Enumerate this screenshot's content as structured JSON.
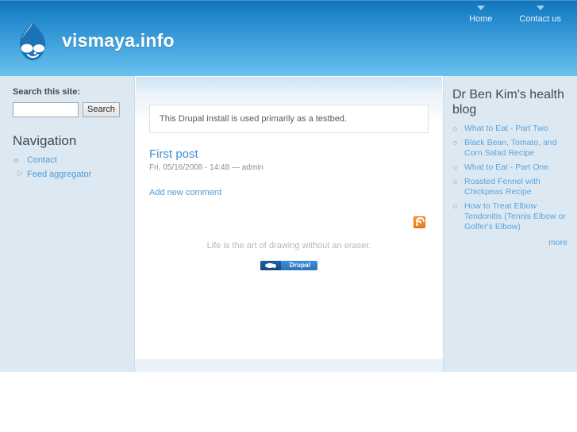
{
  "header": {
    "site_name": "vismaya.info",
    "logo_icon": "drupal-droplet-icon",
    "primary_links": [
      {
        "label": "Home"
      },
      {
        "label": "Contact us"
      }
    ]
  },
  "sidebar_left": {
    "search": {
      "label": "Search this site:",
      "value": "",
      "placeholder": "",
      "button_label": "Search"
    },
    "navigation": {
      "title": "Navigation",
      "items": [
        {
          "label": "Contact",
          "bullet": "circle"
        },
        {
          "label": "Feed aggregator",
          "bullet": "triangle"
        }
      ]
    }
  },
  "main": {
    "message": "This Drupal install is used primarily as a testbed.",
    "node": {
      "title": "First post",
      "submitted": "Fri, 05/16/2008 - 14:48 — admin",
      "add_comment_label": "Add new comment"
    },
    "feed_icon": "rss-feed-icon",
    "footer_message": "Life is the art of drawing without an eraser.",
    "drupal_badge_label": "Drupal"
  },
  "sidebar_right": {
    "title": "Dr Ben Kim's health blog",
    "items": [
      {
        "label": "What to Eat - Part Two"
      },
      {
        "label": "Black Bean, Tomato, and Corn Salad Recipe"
      },
      {
        "label": "What to Eat - Part One"
      },
      {
        "label": "Roasted Fennel with Chickpeas Recipe"
      },
      {
        "label": "How to Treat Elbow Tendonitis (Tennis Elbow or Golfer's Elbow)"
      }
    ],
    "more_label": "more"
  },
  "colors": {
    "header_top": "#0f72b8",
    "header_bottom": "#6cc0ed",
    "page_body": "#eaf1f8",
    "sidebar": "#dde9f2",
    "link": "#4f9bd9",
    "accent_orange": "#ec7a16",
    "drupal_badge": "#2a72ba"
  }
}
